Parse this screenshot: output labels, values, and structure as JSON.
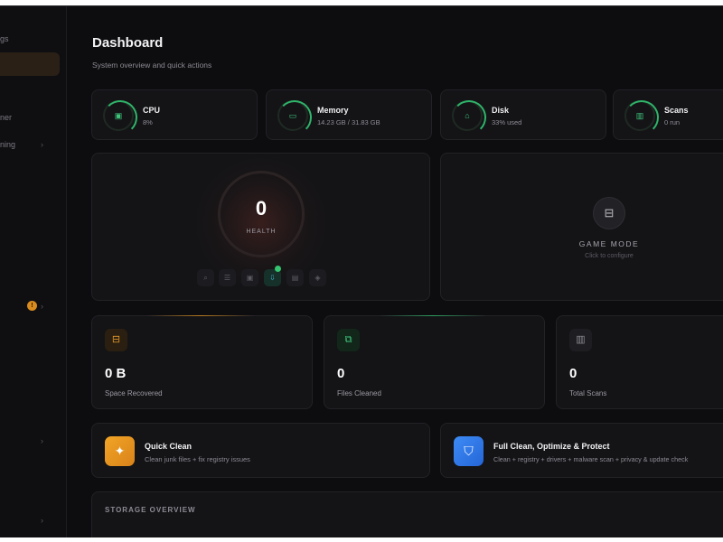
{
  "sidebar": {
    "items": [
      {
        "label": "gs",
        "chevron": ""
      },
      {
        "label": "",
        "chevron": ""
      },
      {
        "label": "ner",
        "chevron": ""
      },
      {
        "label": "ning",
        "chevron": "›"
      },
      {
        "label": "",
        "chevron": "›",
        "badge": "!"
      },
      {
        "label": "",
        "chevron": "›"
      },
      {
        "label": "",
        "chevron": "›"
      }
    ]
  },
  "header": {
    "title": "Dashboard",
    "subtitle": "System overview and quick actions"
  },
  "stats": [
    {
      "label": "CPU",
      "value": "8%",
      "icon": "cpu-icon"
    },
    {
      "label": "Memory",
      "value": "14.23 GB / 31.83 GB",
      "icon": "memory-icon"
    },
    {
      "label": "Disk",
      "value": "33% used",
      "icon": "disk-icon"
    },
    {
      "label": "Scans",
      "value": "0 run",
      "icon": "chart-icon"
    }
  ],
  "health": {
    "score": "0",
    "label": "HEALTH"
  },
  "game_mode": {
    "title": "GAME MODE",
    "subtitle": "Click to configure"
  },
  "metrics": [
    {
      "value": "0 B",
      "label": "Space Recovered",
      "icon": "drive-icon"
    },
    {
      "value": "0",
      "label": "Files Cleaned",
      "icon": "files-icon"
    },
    {
      "value": "0",
      "label": "Total Scans",
      "icon": "bar-chart-icon"
    }
  ],
  "actions": [
    {
      "title": "Quick Clean",
      "subtitle": "Clean junk files + fix registry issues",
      "icon": "sparkle-icon"
    },
    {
      "title": "Full Clean, Optimize & Protect",
      "subtitle": "Clean + registry + drivers + malware scan + privacy & update check",
      "icon": "shield-icon"
    }
  ],
  "storage": {
    "title": "STORAGE OVERVIEW"
  },
  "colors": {
    "background": "#0d0d0f",
    "card": "#141417",
    "accent_green": "#2fb56a",
    "accent_orange": "#f0a020",
    "accent_blue": "#2f7bf0"
  }
}
